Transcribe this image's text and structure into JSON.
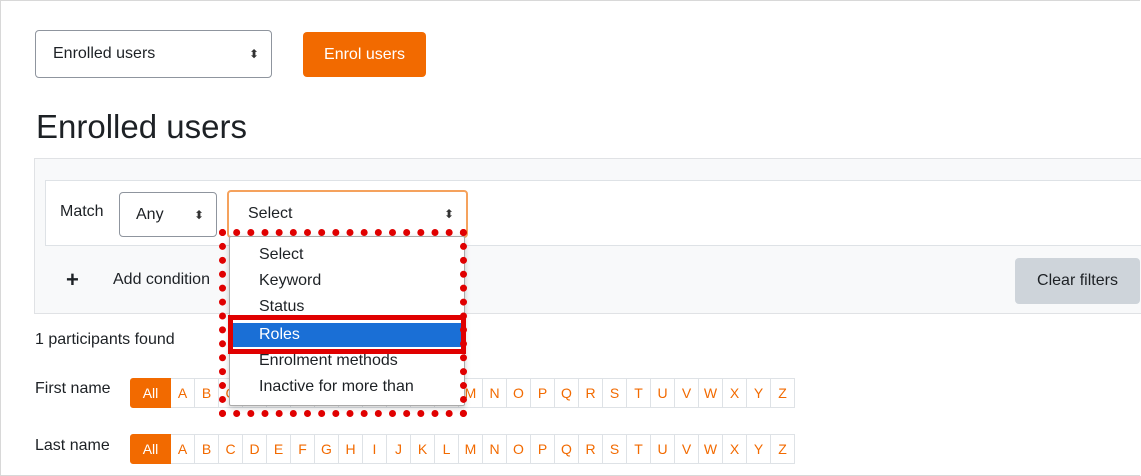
{
  "top": {
    "view_select": "Enrolled users",
    "enrol_button": "Enrol users"
  },
  "page_title": "Enrolled users",
  "filter": {
    "match_label": "Match",
    "match_value": "Any",
    "condition_select": "Select",
    "add_condition": "Add condition",
    "clear_filters": "Clear filters"
  },
  "dropdown_options": [
    "Select",
    "Keyword",
    "Status",
    "Roles",
    "Enrolment methods",
    "Inactive for more than"
  ],
  "highlighted_option": "Roles",
  "participants_found": "1 participants found",
  "first_name_label": "First name",
  "last_name_label": "Last name",
  "initials_all": "All",
  "letters": [
    "A",
    "B",
    "C",
    "D",
    "E",
    "F",
    "G",
    "H",
    "I",
    "J",
    "K",
    "L",
    "M",
    "N",
    "O",
    "P",
    "Q",
    "R",
    "S",
    "T",
    "U",
    "V",
    "W",
    "X",
    "Y",
    "Z"
  ],
  "colors": {
    "accent": "#f26a00",
    "highlight": "#1a6fd6",
    "annotation": "#e00000"
  }
}
